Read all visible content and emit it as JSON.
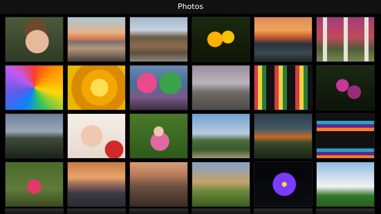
{
  "app": {
    "title": "Photos"
  },
  "gallery": {
    "photos": [
      "child-portrait",
      "coastal-sunset",
      "historic-building",
      "yellow-flowers",
      "rocky-sunset",
      "striped-socks-clogs",
      "rainbow-umbrella",
      "yellow-flower-macro",
      "kids-in-garden",
      "old-house-dusk",
      "kids-striped-socks-on-rocks",
      "pink-flowers-on-dark",
      "statue-garden",
      "baby-with-red-toy",
      "toddler-pink-jacket",
      "country-road-lighthouse",
      "stormy-field",
      "rainbow-socks-closeup",
      "girl-in-pink",
      "sunset-over-sea",
      "beach-rocks-sunset",
      "farmland-landscape",
      "purple-flower-dark",
      "soccer-team-lineup"
    ]
  },
  "colors": {
    "background": "#000000",
    "titlebar": "#111111",
    "text": "#FFFFFF"
  }
}
